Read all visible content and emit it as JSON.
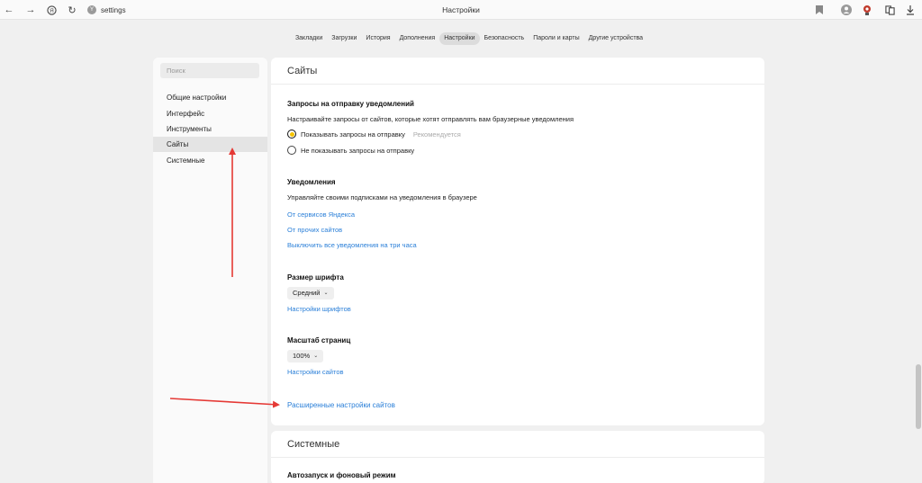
{
  "browser": {
    "address": "settings",
    "window_title": "Настройки"
  },
  "tabs": [
    {
      "label": "Закладки",
      "active": false
    },
    {
      "label": "Загрузки",
      "active": false
    },
    {
      "label": "История",
      "active": false
    },
    {
      "label": "Дополнения",
      "active": false
    },
    {
      "label": "Настройки",
      "active": true
    },
    {
      "label": "Безопасность",
      "active": false
    },
    {
      "label": "Пароли и карты",
      "active": false
    },
    {
      "label": "Другие устройства",
      "active": false
    }
  ],
  "sidebar": {
    "search_placeholder": "Поиск",
    "items": [
      {
        "label": "Общие настройки",
        "active": false
      },
      {
        "label": "Интерфейс",
        "active": false
      },
      {
        "label": "Инструменты",
        "active": false
      },
      {
        "label": "Сайты",
        "active": true
      },
      {
        "label": "Системные",
        "active": false
      }
    ]
  },
  "sites": {
    "title": "Сайты",
    "notif_requests": {
      "title": "Запросы на отправку уведомлений",
      "desc": "Настраивайте запросы от сайтов, которые хотят отправлять вам браузерные уведомления",
      "option_show": "Показывать запросы на отправку",
      "option_show_hint": "Рекомендуется",
      "option_hide": "Не показывать запросы на отправку",
      "selected": "show"
    },
    "notifications": {
      "title": "Уведомления",
      "desc": "Управляйте своими подписками на уведомления в браузере",
      "link_yandex": "От сервисов Яндекса",
      "link_other": "От прочих сайтов",
      "link_disable": "Выключить все уведомления на три часа"
    },
    "font_size": {
      "title": "Размер шрифта",
      "value": "Средний",
      "link": "Настройки шрифтов"
    },
    "page_zoom": {
      "title": "Масштаб страниц",
      "value": "100%",
      "link": "Настройки сайтов"
    },
    "advanced_link": "Расширенные настройки сайтов"
  },
  "system": {
    "title": "Системные",
    "autostart_title": "Автозапуск и фоновый режим"
  },
  "colors": {
    "accent_yellow": "#f7c400",
    "link_blue": "#2a7fd8",
    "annotation_red": "#e53935"
  }
}
